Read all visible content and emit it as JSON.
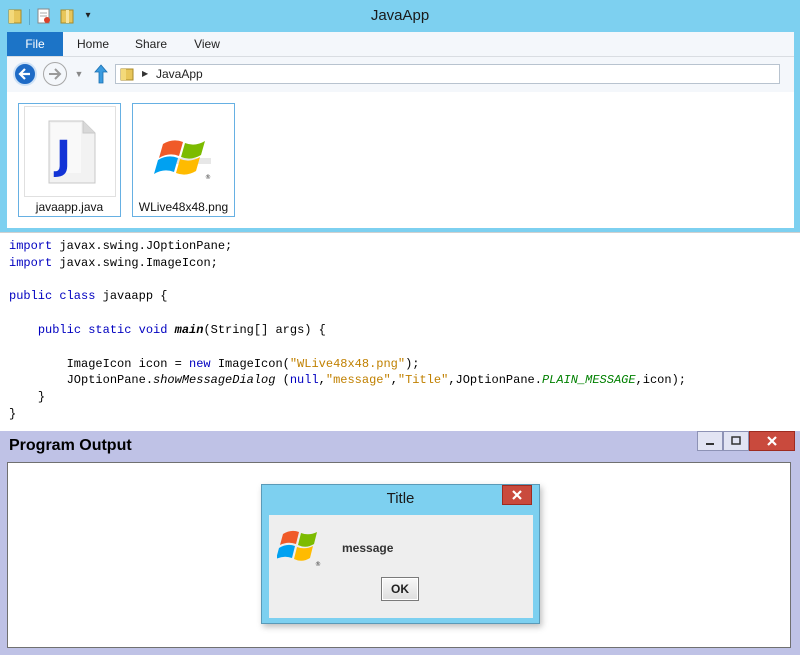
{
  "explorer": {
    "title": "JavaApp",
    "ribbon_tabs": {
      "file": "File",
      "home": "Home",
      "share": "Share",
      "view": "View"
    },
    "address": "JavaApp",
    "files": [
      {
        "name": "javaapp.java",
        "icon": "java-file-icon"
      },
      {
        "name": "WLive48x48.png",
        "icon": "windows-logo-icon"
      }
    ]
  },
  "code": {
    "l1": {
      "kw": "import",
      "rest": " javax.swing.JOptionPane;"
    },
    "l2": {
      "kw": "import",
      "rest": " javax.swing.ImageIcon;"
    },
    "l3": {
      "kw": "public class",
      "rest": " javaapp {"
    },
    "l4": {
      "kw": "public static void",
      "method": "main",
      "rest": "(String[] args) {"
    },
    "l5": {
      "pre": "ImageIcon icon = ",
      "kw": "new",
      "mid": " ImageIcon(",
      "str": "\"WLive48x48.png\"",
      "end": ");"
    },
    "l6": {
      "pre": "JOptionPane.",
      "method": "showMessageDialog",
      "a": " (",
      "kw": "null",
      "b": ",",
      "s1": "\"message\"",
      "c": ",",
      "s2": "\"Title\"",
      "d": ",JOptionPane.",
      "const": "PLAIN_MESSAGE",
      "end": ",icon);"
    },
    "l7": "}",
    "l8": "}"
  },
  "output": {
    "title": "Program Output",
    "dialog": {
      "title": "Title",
      "message": "message",
      "ok": "OK"
    }
  },
  "colors": {
    "titlebar": "#7dd0f0",
    "file_tab": "#1c74c7",
    "keyword": "#0000c0",
    "string": "#c08000",
    "constant": "#008000",
    "output_bg": "#bfc2e6",
    "close_button": "#c94a3d"
  }
}
